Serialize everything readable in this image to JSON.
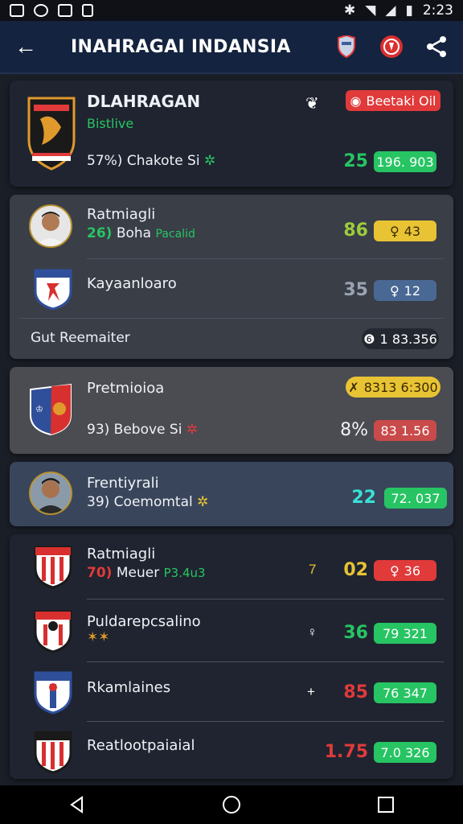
{
  "status": {
    "time": "2:23"
  },
  "header": {
    "title": "INAHRAGAI INDANSIA"
  },
  "card1": {
    "team": "DLAHRAGAN",
    "subtitle": "Bistlive",
    "badge": "Beetaki Oil",
    "stat": "57%) Chakote Si",
    "score": "25",
    "pill": "196. 903"
  },
  "card2": {
    "row1": {
      "name": "Ratmiagli",
      "num": "26)",
      "text": "Boha",
      "tag": "Pacalid",
      "score": "86",
      "pill": "43"
    },
    "row2": {
      "name": "Kayaanloaro",
      "score": "35",
      "pill": "12"
    },
    "footer": {
      "label": "Gut Reemaiter",
      "value": "1 83.356"
    }
  },
  "card3": {
    "name": "Pretmioioa",
    "badge": "8313 6:300",
    "stat": "93) Bebove Si",
    "score": "8%",
    "pill": "83 1.56"
  },
  "card4": {
    "name": "Frentiyrali",
    "stat": "39) Coemomtal",
    "score": "22",
    "pill": "72. 037"
  },
  "card5": {
    "rows": [
      {
        "name": "Ratmiagli",
        "num": "70)",
        "text": "Meuer",
        "tag": "P3.4u3",
        "mark": "7",
        "score": "02",
        "pill": "36"
      },
      {
        "name": "Puldarepcsalino",
        "mark": "♀",
        "score": "36",
        "pill": "79 321"
      },
      {
        "name": "Rkamlaines",
        "mark": "+",
        "score": "85",
        "pill": "76 347"
      },
      {
        "name": "Reatlootpaiaial",
        "mark": "",
        "score": "1.75",
        "pill": "7.0 326"
      }
    ]
  },
  "colors": {
    "green": "#27c463",
    "red": "#e03a3a",
    "yellow": "#e8c334",
    "blue": "#3b5f9b",
    "cyan": "#3ae0d6"
  }
}
